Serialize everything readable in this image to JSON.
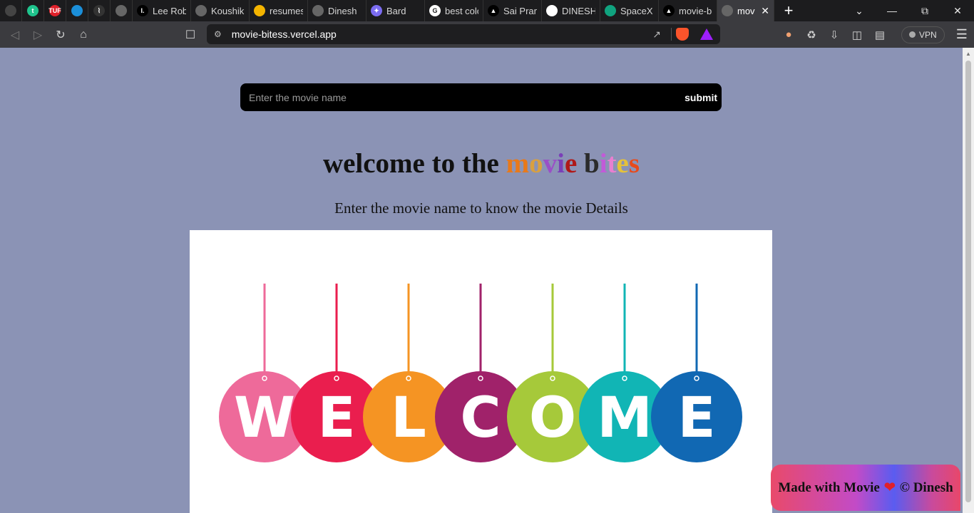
{
  "browser": {
    "tabs": [
      {
        "title": "",
        "icon": "bell-icon",
        "color": "#444444",
        "glyph": "",
        "kind": "pinned"
      },
      {
        "title": "",
        "icon": "t-icon",
        "color": "#1fc48d",
        "glyph": "t",
        "kind": "pinned"
      },
      {
        "title": "",
        "icon": "tuf-icon",
        "color": "#e0202a",
        "glyph": "TUF",
        "kind": "pinned"
      },
      {
        "title": "",
        "icon": "cloud-icon",
        "color": "#1b8fd9",
        "glyph": "",
        "kind": "pinned"
      },
      {
        "title": "",
        "icon": "waves-icon",
        "color": "#333333",
        "glyph": "⌇",
        "kind": "pinned"
      },
      {
        "title": "",
        "icon": "globe-icon",
        "color": "#666666",
        "glyph": "",
        "kind": "pinned"
      },
      {
        "title": "Lee Robi",
        "icon": "l-icon",
        "color": "#000000",
        "glyph": "I.",
        "kind": "normal"
      },
      {
        "title": "Koushik",
        "icon": "globe-icon",
        "color": "#666666",
        "glyph": "",
        "kind": "normal"
      },
      {
        "title": "resumes",
        "icon": "drive-icon",
        "color": "#f4b400",
        "glyph": "",
        "kind": "normal"
      },
      {
        "title": "Dinesh",
        "icon": "globe-icon",
        "color": "#666666",
        "glyph": "",
        "kind": "normal"
      },
      {
        "title": "Bard",
        "icon": "sparkle-icon",
        "color": "#7b6cf0",
        "glyph": "✦",
        "kind": "normal"
      },
      {
        "title": "best colo",
        "icon": "google-icon",
        "color": "#ffffff",
        "glyph": "G",
        "kind": "normal"
      },
      {
        "title": "Sai Prana",
        "icon": "triangle-icon",
        "color": "#000000",
        "glyph": "▲",
        "kind": "normal"
      },
      {
        "title": "DINESH-",
        "icon": "github-icon",
        "color": "#ffffff",
        "glyph": "",
        "kind": "normal"
      },
      {
        "title": "SpaceX E",
        "icon": "chatgpt-icon",
        "color": "#10a37f",
        "glyph": "",
        "kind": "normal"
      },
      {
        "title": "movie-b",
        "icon": "triangle-icon",
        "color": "#000000",
        "glyph": "▲",
        "kind": "normal"
      },
      {
        "title": "mov",
        "icon": "globe-icon",
        "color": "#666666",
        "glyph": "",
        "kind": "active"
      }
    ],
    "url": "movie-bitess.vercel.app",
    "vpn_label": "VPN"
  },
  "search": {
    "placeholder": "Enter the movie name",
    "submit_label": "submit"
  },
  "heading": {
    "prefix": "welcome to the ",
    "colored_chars": [
      {
        "ch": "m",
        "color": "#e8791a"
      },
      {
        "ch": "o",
        "color": "#d9a040"
      },
      {
        "ch": "v",
        "color": "#9b4fc7"
      },
      {
        "ch": "i",
        "color": "#7a3fb8"
      },
      {
        "ch": "e",
        "color": "#b01818"
      },
      {
        "ch": " ",
        "color": "#111111"
      },
      {
        "ch": "b",
        "color": "#2b2b2b"
      },
      {
        "ch": "i",
        "color": "#c25ad8"
      },
      {
        "ch": "t",
        "color": "#e87fd0"
      },
      {
        "ch": "e",
        "color": "#e6c23a"
      },
      {
        "ch": "s",
        "color": "#e84a1a"
      }
    ]
  },
  "subtitle": "Enter the movie name to know the movie Details",
  "welcome_banner": {
    "letters": [
      {
        "ch": "W",
        "color": "#ee6a9a"
      },
      {
        "ch": "E",
        "color": "#ea1e4e"
      },
      {
        "ch": "L",
        "color": "#f59423"
      },
      {
        "ch": "C",
        "color": "#a0226a"
      },
      {
        "ch": "O",
        "color": "#a6c93a"
      },
      {
        "ch": "M",
        "color": "#11b5b5"
      },
      {
        "ch": "E",
        "color": "#1168b3"
      }
    ]
  },
  "footer": {
    "text_before": "Made with Movie",
    "heart": "❤",
    "text_after": "© Dinesh"
  }
}
